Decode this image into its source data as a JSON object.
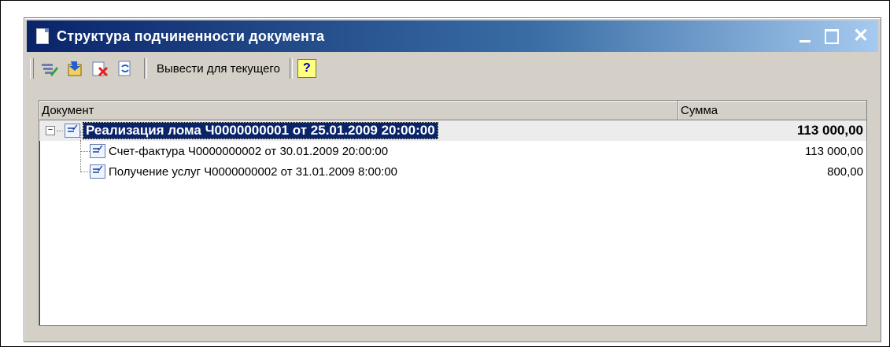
{
  "window": {
    "title": "Структура подчиненности документа",
    "controls": {
      "minimize": "_",
      "close": "✕"
    }
  },
  "toolbar": {
    "output_current_label": "Вывести для текущего",
    "help_label": "?"
  },
  "table": {
    "columns": [
      "Документ",
      "Сумма"
    ],
    "rows": [
      {
        "document": "Реализация лома Ч0000000001 от 25.01.2009 20:00:00",
        "sum": "113 000,00"
      },
      {
        "document": "Счет-фактура Ч0000000002 от 30.01.2009 20:00:00",
        "sum": "113 000,00"
      },
      {
        "document": "Получение услуг Ч0000000002 от 31.01.2009 8:00:00",
        "sum": "800,00"
      }
    ]
  },
  "colors": {
    "title_active": "#0a246a",
    "selection": "#0a246a",
    "face": "#d4d0c8"
  }
}
